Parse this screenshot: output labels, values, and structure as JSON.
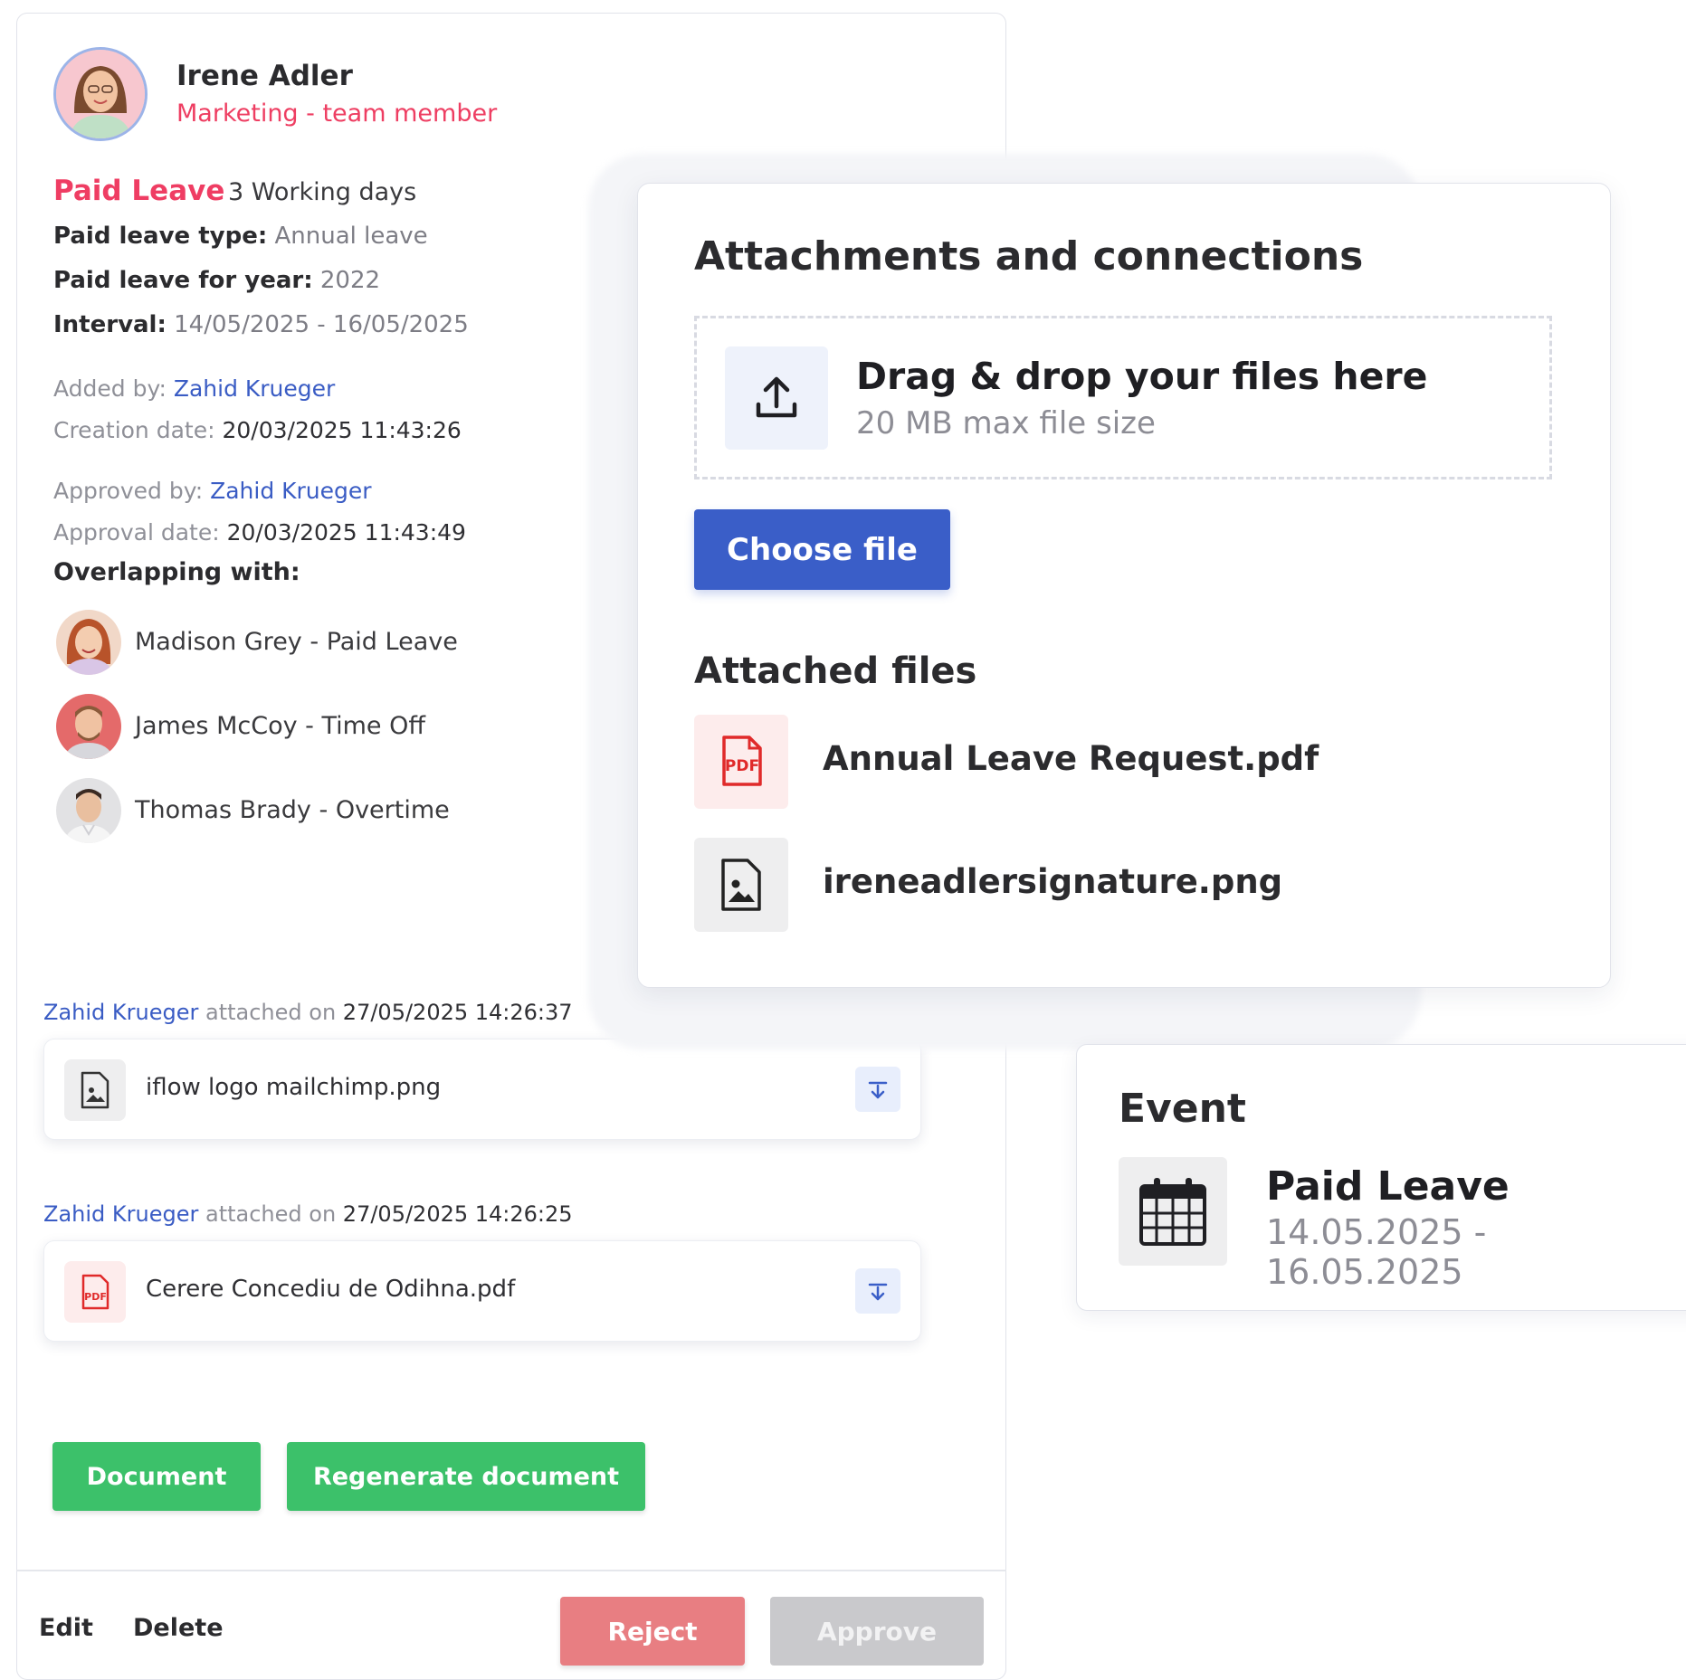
{
  "employee": {
    "name": "Irene Adler",
    "role": "Marketing - team member"
  },
  "leave": {
    "type": "Paid Leave",
    "working_days": "3 Working days",
    "paid_leave_type_label": "Paid leave type:",
    "paid_leave_type_value": "Annual leave",
    "paid_leave_year_label": "Paid leave for year:",
    "paid_leave_year_value": "2022",
    "interval_label": "Interval:",
    "interval_value": "14/05/2025 - 16/05/2025"
  },
  "meta": {
    "added_by_label": "Added by:",
    "added_by_value": "Zahid Krueger",
    "creation_date_label": "Creation date:",
    "creation_date_value": "20/03/2025 11:43:26",
    "approved_by_label": "Approved by:",
    "approved_by_value": "Zahid Krueger",
    "approval_date_label": "Approval date:",
    "approval_date_value": "20/03/2025 11:43:49"
  },
  "overlap": {
    "title": "Overlapping with:",
    "items": [
      {
        "text": "Madison Grey - Paid Leave"
      },
      {
        "text": "James McCoy - Time Off"
      },
      {
        "text": "Thomas Brady - Overtime"
      }
    ]
  },
  "history": [
    {
      "user": "Zahid Krueger",
      "action": "attached on",
      "timestamp": "27/05/2025 14:26:37",
      "file": "iflow logo mailchimp.png",
      "icon": "image-file-icon"
    },
    {
      "user": "Zahid Krueger",
      "action": "attached on",
      "timestamp": "27/05/2025 14:26:25",
      "file": "Cerere Concediu de Odihna.pdf",
      "icon": "pdf-file-icon"
    }
  ],
  "actions": {
    "document": "Document",
    "regenerate": "Regenerate document",
    "edit": "Edit",
    "delete": "Delete",
    "reject": "Reject",
    "approve": "Approve"
  },
  "attachments": {
    "title": "Attachments and connections",
    "dropzone_title": "Drag & drop your files here",
    "dropzone_subtitle": "20 MB max file size",
    "choose_file": "Choose file",
    "attached_title": "Attached files",
    "files": [
      {
        "name": "Annual Leave Request.pdf",
        "icon": "pdf-file-icon"
      },
      {
        "name": "ireneadlersignature.png",
        "icon": "image-file-icon"
      }
    ]
  },
  "event": {
    "title": "Event",
    "name": "Paid Leave",
    "dates": "14.05.2025 - 16.05.2025",
    "icon": "calendar-icon"
  },
  "colors": {
    "accent_red": "#ef3d63",
    "link_blue": "#3a5cc4",
    "primary_blue": "#3a5ec8",
    "green": "#3cc16a",
    "reject": "#e87e82",
    "approve_disabled": "#c9c9cc"
  }
}
